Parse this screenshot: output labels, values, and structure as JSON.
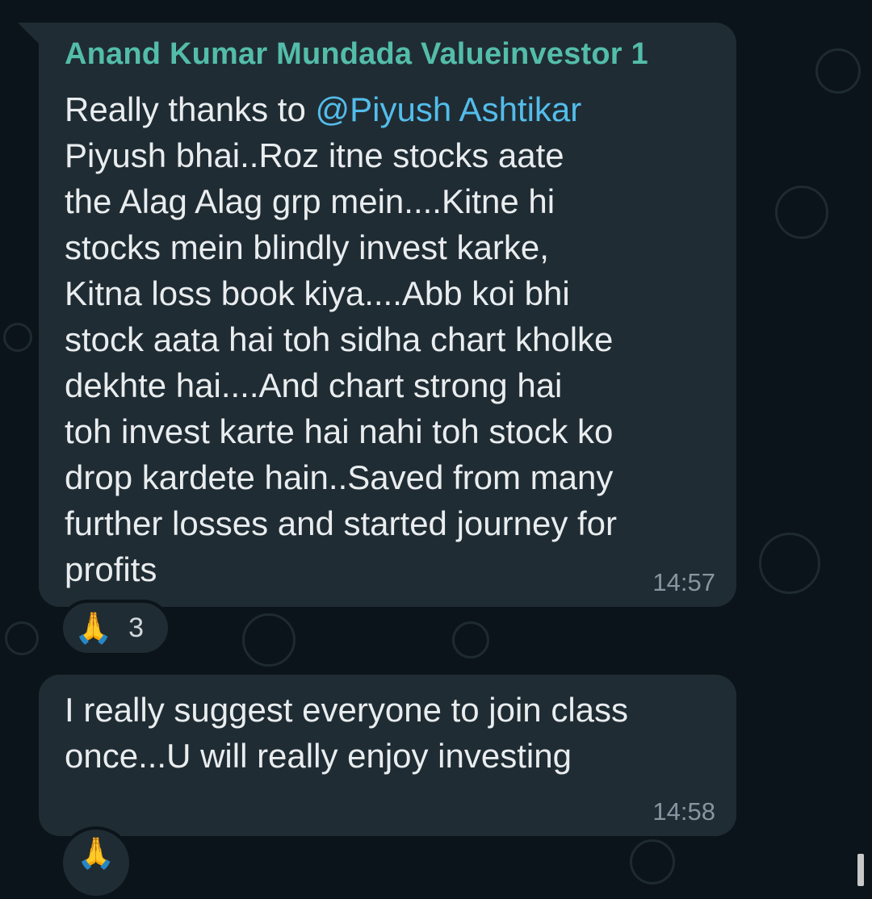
{
  "messages": [
    {
      "sender": "Anand Kumar Mundada Valueinvestor 1",
      "text_prefix": "Really thanks to ",
      "mention": "@Piyush Ashtikar",
      "text_body": "Piyush bhai..Roz itne stocks aate\nthe Alag Alag grp mein....Kitne hi\nstocks mein blindly invest karke,\nKitna loss book kiya....Abb koi bhi\nstock aata hai toh sidha chart kholke\ndekhte hai....And chart strong hai\ntoh invest karte hai nahi toh stock ko\ndrop kardete hain..Saved from many\nfurther losses and started  journey for\nprofits",
      "time": "14:57",
      "reaction": {
        "emoji": "🙏",
        "count": "3"
      }
    },
    {
      "text": "I really suggest everyone to join class\nonce...U will really enjoy investing",
      "time": "14:58",
      "reaction": {
        "emoji": "🙏"
      }
    }
  ],
  "colors": {
    "background": "#0b141a",
    "bubble": "#202c33",
    "sender_name": "#53bdaa",
    "mention": "#53bdeb",
    "text": "#e9edef",
    "timestamp": "#8696a0"
  }
}
